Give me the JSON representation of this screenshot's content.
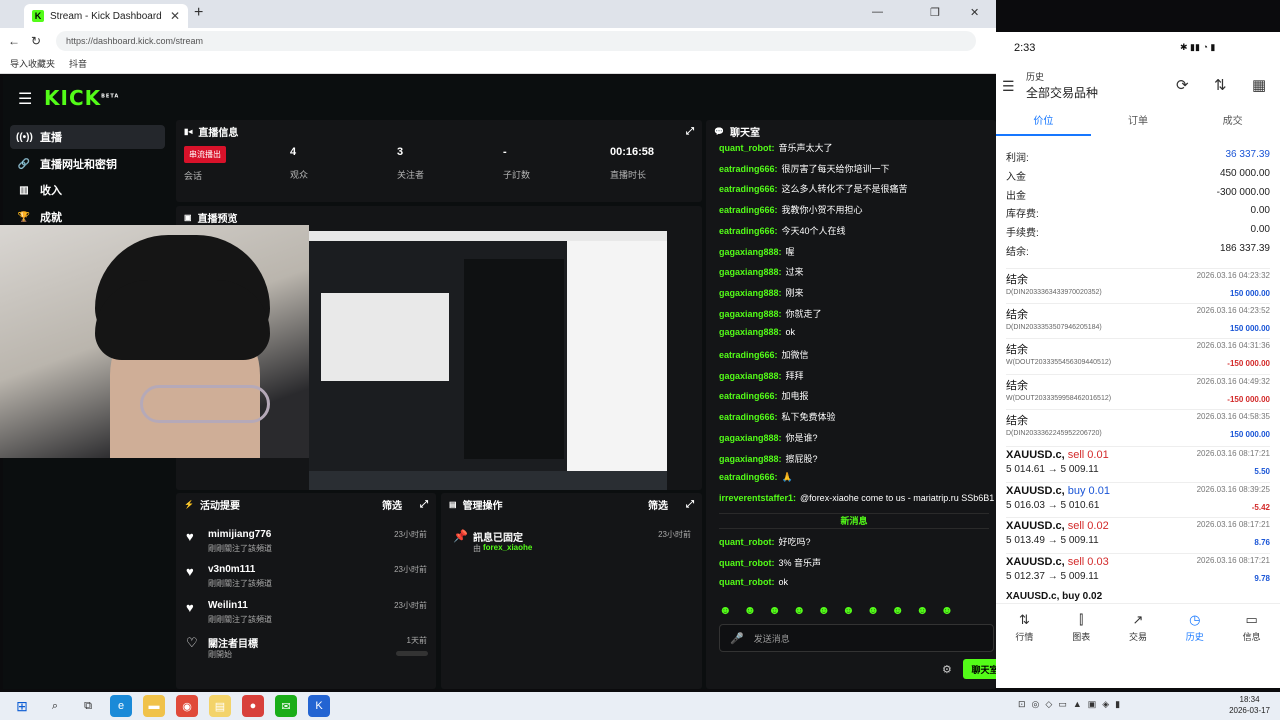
{
  "browser": {
    "tab_title": "Stream - Kick Dashboard",
    "url": "https://dashboard.kick.com/stream",
    "bookmarks": [
      "导入收藏夹",
      "抖音"
    ]
  },
  "app": {
    "logo": "KICK",
    "logo_badge": "BETA",
    "sidebar": [
      {
        "label": "直播",
        "icon": "broadcast-icon"
      },
      {
        "label": "直播网址和密钥",
        "icon": "link-icon"
      },
      {
        "label": "收入",
        "icon": "chart-icon"
      },
      {
        "label": "成就",
        "icon": "trophy-icon"
      }
    ],
    "stream_info": {
      "title": "直播信息",
      "badge": "串流播出",
      "session_label": "会话",
      "stats": [
        {
          "value": "4",
          "label": "观众"
        },
        {
          "value": "3",
          "label": "关注者"
        },
        {
          "value": "-",
          "label": "子訂数"
        },
        {
          "value": "00:16:58",
          "label": "直播时长"
        }
      ]
    },
    "preview_title": "直播预览",
    "activity": {
      "title": "活动提要",
      "filter": "筛选",
      "items": [
        {
          "name": "mimijiang776",
          "sub": "剛剛關注了該頻道",
          "time": "23小时前"
        },
        {
          "name": "v3n0m111",
          "sub": "剛剛關注了該頻道",
          "time": "23小时前"
        },
        {
          "name": "Weilin11",
          "sub": "剛剛關注了該頻道",
          "time": "23小时前"
        },
        {
          "name": "關注者目標",
          "sub": "剛開始",
          "time": "1天前"
        }
      ]
    },
    "mod": {
      "title": "管理操作",
      "filter": "筛选",
      "item_title": "訊息已固定",
      "item_by": "由",
      "item_user": "forex_xiaohe",
      "item_time": "23小时前"
    },
    "chat": {
      "title": "聊天室",
      "messages": [
        {
          "user": "quant_robot:",
          "text": "音乐声太大了"
        },
        {
          "user": "eatrading666:",
          "text": "很厉害了每天给你培训一下"
        },
        {
          "user": "eatrading666:",
          "text": "这么多人转化不了是不是很痛苦"
        },
        {
          "user": "eatrading666:",
          "text": "我教你小贺不用担心"
        },
        {
          "user": "eatrading666:",
          "text": "今天40个人在线"
        },
        {
          "user": "gagaxiang888:",
          "text": "喔"
        },
        {
          "user": "gagaxiang888:",
          "text": "过来"
        },
        {
          "user": "gagaxiang888:",
          "text": "刚来"
        },
        {
          "user": "gagaxiang888:",
          "text": "你就走了"
        },
        {
          "user": "gagaxiang888:",
          "text": "ok"
        },
        {
          "user": "eatrading666:",
          "text": "加微信"
        },
        {
          "user": "gagaxiang888:",
          "text": "拜拜"
        },
        {
          "user": "eatrading666:",
          "text": "加电报"
        },
        {
          "user": "eatrading666:",
          "text": "私下免费体验"
        },
        {
          "user": "gagaxiang888:",
          "text": "你是谁?"
        },
        {
          "user": "gagaxiang888:",
          "text": "擦屁股?"
        },
        {
          "user": "eatrading666:",
          "text": "🙏"
        },
        {
          "user": "irreverentstaffer1:",
          "text": "@forex-xiaohe come to us - mariatrip.ru SSb6B1"
        }
      ],
      "new_divider": "新消息",
      "new_messages": [
        {
          "user": "quant_robot:",
          "text": "好吃吗?"
        },
        {
          "user": "quant_robot:",
          "text": "3% 音乐声"
        },
        {
          "user": "quant_robot:",
          "text": "ok"
        }
      ],
      "input_placeholder": "发送消息",
      "send_button": "聊天室"
    }
  },
  "phone": {
    "status_time": "2:33",
    "title_small": "历史",
    "title_main": "全部交易品种",
    "tabs": [
      "价位",
      "订单",
      "成交"
    ],
    "summary": [
      {
        "label": "利润:",
        "value": "36 337.39"
      },
      {
        "label": "入金",
        "value": "450 000.00"
      },
      {
        "label": "出金",
        "value": "-300 000.00"
      },
      {
        "label": "库存费:",
        "value": "0.00"
      },
      {
        "label": "手续费:",
        "value": "0.00"
      },
      {
        "label": "结余:",
        "value": "186 337.39"
      }
    ],
    "deals": [
      {
        "title": "结余",
        "id": "D(DIN2033363433970020352)",
        "date": "2026.03.16 04:23:32",
        "amount": "150 000.00",
        "neg": false
      },
      {
        "title": "结余",
        "id": "D(DIN2033353507946205184)",
        "date": "2026.03.16 04:23:52",
        "amount": "150 000.00",
        "neg": false
      },
      {
        "title": "结余",
        "id": "W(DOUT2033355456309440512)",
        "date": "2026.03.16 04:31:36",
        "amount": "-150 000.00",
        "neg": true
      },
      {
        "title": "结余",
        "id": "W(DOUT2033359958462016512)",
        "date": "2026.03.16 04:49:32",
        "amount": "-150 000.00",
        "neg": true
      },
      {
        "title": "结余",
        "id": "D(DIN2033362245952206720)",
        "date": "2026.03.16 04:58:35",
        "amount": "150 000.00",
        "neg": false
      }
    ],
    "trades": [
      {
        "sym": "XAUUSD.c,",
        "side": "sell 0.01",
        "prices": "5 014.61 → 5 009.11",
        "date": "2026.03.16 08:17:21",
        "pl": "5.50",
        "neg": false
      },
      {
        "sym": "XAUUSD.c,",
        "side": "buy 0.01",
        "prices": "5 016.03 → 5 010.61",
        "date": "2026.03.16 08:39:25",
        "pl": "-5.42",
        "neg": true
      },
      {
        "sym": "XAUUSD.c,",
        "side": "sell 0.02",
        "prices": "5 013.49 → 5 009.11",
        "date": "2026.03.16 08:17:21",
        "pl": "8.76",
        "neg": false
      },
      {
        "sym": "XAUUSD.c,",
        "side": "sell 0.03",
        "prices": "5 012.37 → 5 009.11",
        "date": "2026.03.16 08:17:21",
        "pl": "9.78",
        "neg": false
      }
    ],
    "partial": "XAUUSD.c, buy 0.02",
    "nav": [
      {
        "label": "行情",
        "icon": "⇅"
      },
      {
        "label": "图表",
        "icon": "⫿"
      },
      {
        "label": "交易",
        "icon": "↗"
      },
      {
        "label": "历史",
        "icon": "◷"
      },
      {
        "label": "信息",
        "icon": "▭"
      }
    ]
  },
  "taskbar": {
    "time": "18:34",
    "date": "2026-03-17"
  }
}
